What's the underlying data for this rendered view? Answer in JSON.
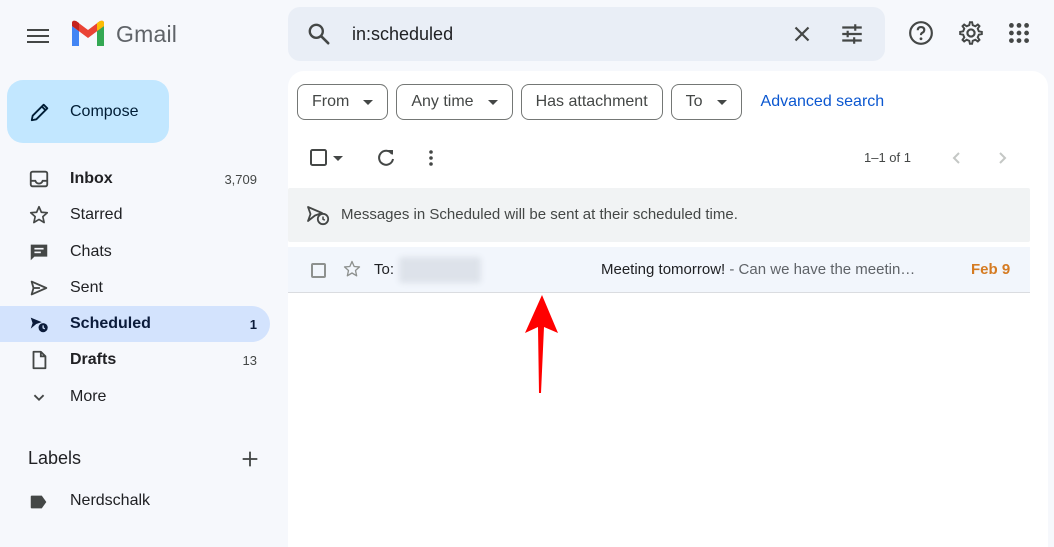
{
  "app": {
    "name": "Gmail"
  },
  "search": {
    "query": "in:scheduled"
  },
  "compose": {
    "label": "Compose"
  },
  "nav": {
    "items": [
      {
        "label": "Inbox",
        "count": "3,709",
        "icon": "inbox-icon"
      },
      {
        "label": "Starred",
        "count": "",
        "icon": "star-icon"
      },
      {
        "label": "Chats",
        "count": "",
        "icon": "chat-icon"
      },
      {
        "label": "Sent",
        "count": "",
        "icon": "send-icon"
      },
      {
        "label": "Scheduled",
        "count": "1",
        "icon": "scheduled-send-icon"
      },
      {
        "label": "Drafts",
        "count": "13",
        "icon": "draft-icon"
      },
      {
        "label": "More",
        "count": "",
        "icon": "chevron-down-icon"
      }
    ]
  },
  "labels": {
    "header": "Labels",
    "items": [
      {
        "label": "Nerdschalk"
      }
    ]
  },
  "filters": {
    "from": "From",
    "any_time": "Any time",
    "has_attachment": "Has attachment",
    "to": "To",
    "advanced": "Advanced search"
  },
  "toolbar": {
    "page_info": "1–1 of 1"
  },
  "notice": {
    "text": "Messages in Scheduled will be sent at their scheduled time."
  },
  "emails": [
    {
      "to_prefix": "To:",
      "subject": "Meeting tomorrow!",
      "snippet": " - Can we have the meetin…",
      "date": "Feb 9"
    }
  ],
  "colors": {
    "accent": "#0b57d0",
    "active_nav": "#d3e3fd",
    "compose": "#c2e7ff",
    "date": "#d57b22",
    "annotation_arrow": "#ff0000"
  }
}
